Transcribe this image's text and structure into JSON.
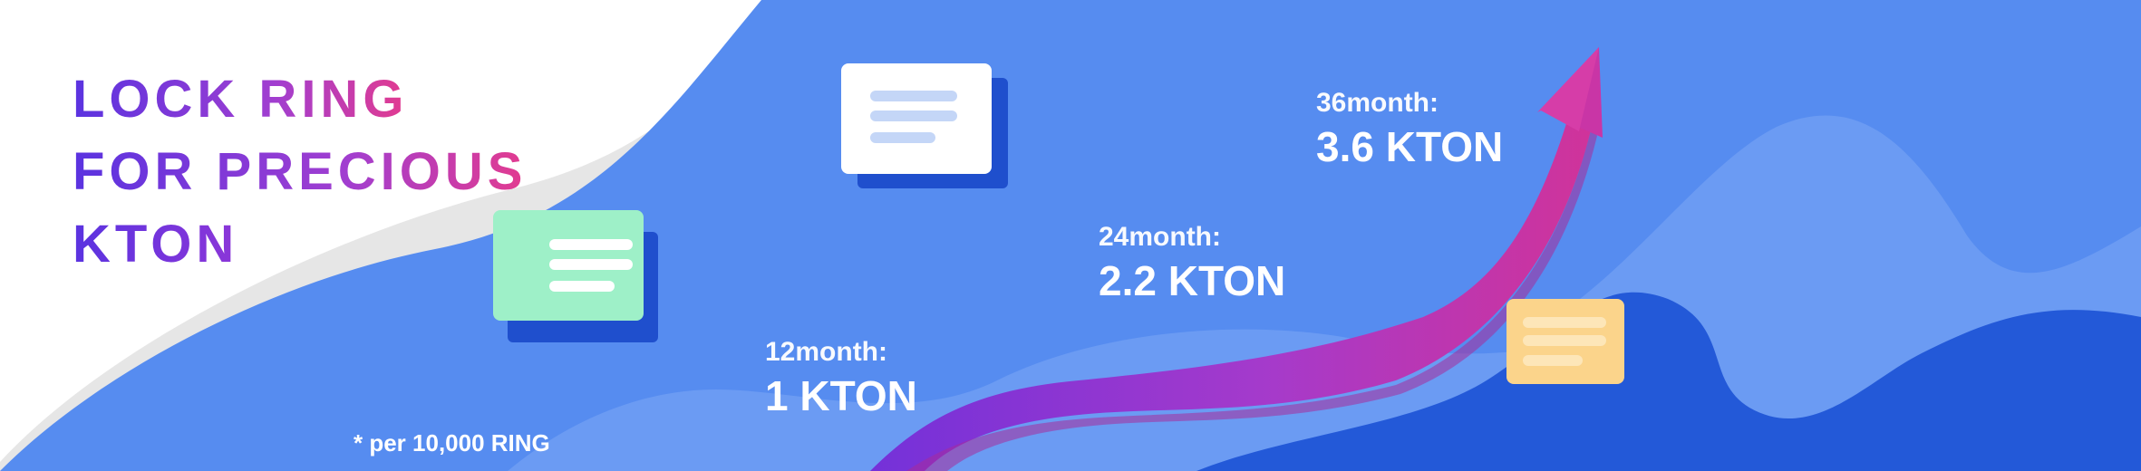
{
  "banner": {
    "title_lines": [
      "LOCK RING",
      "FOR PRECIOUS",
      "KTON"
    ],
    "footnote": "* per 10,000 RING",
    "milestones": [
      {
        "label": "12month:",
        "value": "1 KTON"
      },
      {
        "label": "24month:",
        "value": "2.2 KTON"
      },
      {
        "label": "36month:",
        "value": "3.6 KTON"
      }
    ],
    "colors": {
      "background_blue": "#568cf0",
      "wave_light": "#6b9bf3",
      "wave_dark": "#2359d8",
      "arrow_start": "#7431d9",
      "arrow_end": "#d0339a",
      "card_green": "#9ef0c8",
      "card_white": "#ffffff",
      "card_orange": "#fbd48b",
      "card_shadow": "#1f4fcd"
    },
    "icons": [
      "document-card-icon",
      "document-card-icon",
      "document-card-icon",
      "growth-arrow-icon"
    ]
  }
}
